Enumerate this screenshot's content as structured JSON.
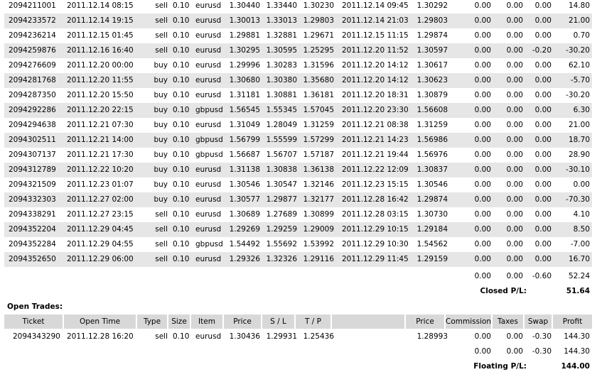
{
  "closed_trades": [
    {
      "ticket": "2094211001",
      "open_time": "2011.12.14 08:15",
      "type": "sell",
      "size": "0.10",
      "item": "eurusd",
      "price": "1.30440",
      "sl": "1.33440",
      "tp": "1.30230",
      "close_time": "2011.12.14 09:45",
      "close_price": "1.30292",
      "commission": "0.00",
      "taxes": "0.00",
      "swap": "0.00",
      "profit": "14.80"
    },
    {
      "ticket": "2094233572",
      "open_time": "2011.12.14 19:15",
      "type": "sell",
      "size": "0.10",
      "item": "eurusd",
      "price": "1.30013",
      "sl": "1.33013",
      "tp": "1.29803",
      "close_time": "2011.12.14 21:03",
      "close_price": "1.29803",
      "commission": "0.00",
      "taxes": "0.00",
      "swap": "0.00",
      "profit": "21.00"
    },
    {
      "ticket": "2094236214",
      "open_time": "2011.12.15 01:45",
      "type": "sell",
      "size": "0.10",
      "item": "eurusd",
      "price": "1.29881",
      "sl": "1.32881",
      "tp": "1.29671",
      "close_time": "2011.12.15 11:15",
      "close_price": "1.29874",
      "commission": "0.00",
      "taxes": "0.00",
      "swap": "0.00",
      "profit": "0.70"
    },
    {
      "ticket": "2094259876",
      "open_time": "2011.12.16 16:40",
      "type": "sell",
      "size": "0.10",
      "item": "eurusd",
      "price": "1.30295",
      "sl": "1.30595",
      "tp": "1.25295",
      "close_time": "2011.12.20 11:52",
      "close_price": "1.30597",
      "commission": "0.00",
      "taxes": "0.00",
      "swap": "-0.20",
      "profit": "-30.20"
    },
    {
      "ticket": "2094276609",
      "open_time": "2011.12.20 00:00",
      "type": "buy",
      "size": "0.10",
      "item": "eurusd",
      "price": "1.29996",
      "sl": "1.30283",
      "tp": "1.31596",
      "close_time": "2011.12.20 14:12",
      "close_price": "1.30617",
      "commission": "0.00",
      "taxes": "0.00",
      "swap": "0.00",
      "profit": "62.10"
    },
    {
      "ticket": "2094281768",
      "open_time": "2011.12.20 11:55",
      "type": "buy",
      "size": "0.10",
      "item": "eurusd",
      "price": "1.30680",
      "sl": "1.30380",
      "tp": "1.35680",
      "close_time": "2011.12.20 14:12",
      "close_price": "1.30623",
      "commission": "0.00",
      "taxes": "0.00",
      "swap": "0.00",
      "profit": "-5.70"
    },
    {
      "ticket": "2094287350",
      "open_time": "2011.12.20 15:50",
      "type": "buy",
      "size": "0.10",
      "item": "eurusd",
      "price": "1.31181",
      "sl": "1.30881",
      "tp": "1.36181",
      "close_time": "2011.12.20 18:31",
      "close_price": "1.30879",
      "commission": "0.00",
      "taxes": "0.00",
      "swap": "0.00",
      "profit": "-30.20"
    },
    {
      "ticket": "2094292286",
      "open_time": "2011.12.20 22:15",
      "type": "buy",
      "size": "0.10",
      "item": "gbpusd",
      "price": "1.56545",
      "sl": "1.55345",
      "tp": "1.57045",
      "close_time": "2011.12.20 23:30",
      "close_price": "1.56608",
      "commission": "0.00",
      "taxes": "0.00",
      "swap": "0.00",
      "profit": "6.30"
    },
    {
      "ticket": "2094294638",
      "open_time": "2011.12.21 07:30",
      "type": "buy",
      "size": "0.10",
      "item": "eurusd",
      "price": "1.31049",
      "sl": "1.28049",
      "tp": "1.31259",
      "close_time": "2011.12.21 08:38",
      "close_price": "1.31259",
      "commission": "0.00",
      "taxes": "0.00",
      "swap": "0.00",
      "profit": "21.00"
    },
    {
      "ticket": "2094302511",
      "open_time": "2011.12.21 14:00",
      "type": "buy",
      "size": "0.10",
      "item": "gbpusd",
      "price": "1.56799",
      "sl": "1.55599",
      "tp": "1.57299",
      "close_time": "2011.12.21 14:23",
      "close_price": "1.56986",
      "commission": "0.00",
      "taxes": "0.00",
      "swap": "0.00",
      "profit": "18.70"
    },
    {
      "ticket": "2094307137",
      "open_time": "2011.12.21 17:30",
      "type": "buy",
      "size": "0.10",
      "item": "gbpusd",
      "price": "1.56687",
      "sl": "1.56707",
      "tp": "1.57187",
      "close_time": "2011.12.21 19:44",
      "close_price": "1.56976",
      "commission": "0.00",
      "taxes": "0.00",
      "swap": "0.00",
      "profit": "28.90"
    },
    {
      "ticket": "2094312789",
      "open_time": "2011.12.22 10:20",
      "type": "buy",
      "size": "0.10",
      "item": "eurusd",
      "price": "1.31138",
      "sl": "1.30838",
      "tp": "1.36138",
      "close_time": "2011.12.22 12:09",
      "close_price": "1.30837",
      "commission": "0.00",
      "taxes": "0.00",
      "swap": "0.00",
      "profit": "-30.10"
    },
    {
      "ticket": "2094321509",
      "open_time": "2011.12.23 01:07",
      "type": "buy",
      "size": "0.10",
      "item": "eurusd",
      "price": "1.30546",
      "sl": "1.30547",
      "tp": "1.32146",
      "close_time": "2011.12.23 15:15",
      "close_price": "1.30546",
      "commission": "0.00",
      "taxes": "0.00",
      "swap": "0.00",
      "profit": "0.00"
    },
    {
      "ticket": "2094332303",
      "open_time": "2011.12.27 02:00",
      "type": "buy",
      "size": "0.10",
      "item": "eurusd",
      "price": "1.30577",
      "sl": "1.29877",
      "tp": "1.32177",
      "close_time": "2011.12.28 16:42",
      "close_price": "1.29874",
      "commission": "0.00",
      "taxes": "0.00",
      "swap": "0.00",
      "profit": "-70.30"
    },
    {
      "ticket": "2094338291",
      "open_time": "2011.12.27 23:15",
      "type": "sell",
      "size": "0.10",
      "item": "eurusd",
      "price": "1.30689",
      "sl": "1.27689",
      "tp": "1.30899",
      "close_time": "2011.12.28 03:15",
      "close_price": "1.30730",
      "commission": "0.00",
      "taxes": "0.00",
      "swap": "0.00",
      "profit": "4.10"
    },
    {
      "ticket": "2094352204",
      "open_time": "2011.12.29 04:45",
      "type": "sell",
      "size": "0.10",
      "item": "eurusd",
      "price": "1.29269",
      "sl": "1.29259",
      "tp": "1.29009",
      "close_time": "2011.12.29 10:15",
      "close_price": "1.29184",
      "commission": "0.00",
      "taxes": "0.00",
      "swap": "0.00",
      "profit": "8.50"
    },
    {
      "ticket": "2094352284",
      "open_time": "2011.12.29 04:55",
      "type": "sell",
      "size": "0.10",
      "item": "gbpusd",
      "price": "1.54492",
      "sl": "1.55692",
      "tp": "1.53992",
      "close_time": "2011.12.29 10:30",
      "close_price": "1.54562",
      "commission": "0.00",
      "taxes": "0.00",
      "swap": "0.00",
      "profit": "-7.00"
    },
    {
      "ticket": "2094352650",
      "open_time": "2011.12.29 06:00",
      "type": "sell",
      "size": "0.10",
      "item": "eurusd",
      "price": "1.29326",
      "sl": "1.32326",
      "tp": "1.29116",
      "close_time": "2011.12.29 11:45",
      "close_price": "1.29159",
      "commission": "0.00",
      "taxes": "0.00",
      "swap": "0.00",
      "profit": "16.70"
    }
  ],
  "closed_totals": {
    "commission": "0.00",
    "taxes": "0.00",
    "swap": "-0.60",
    "profit": "52.24"
  },
  "closed_pl": {
    "label": "Closed P/L:",
    "value": "51.64"
  },
  "open_section_title": "Open Trades:",
  "open_headers": {
    "ticket": "Ticket",
    "open_time": "Open Time",
    "type": "Type",
    "size": "Size",
    "item": "Item",
    "price": "Price",
    "sl": "S / L",
    "tp": "T / P",
    "blank": "",
    "cur_price": "Price",
    "commission": "Commission",
    "taxes": "Taxes",
    "swap": "Swap",
    "profit": "Profit"
  },
  "open_trades": [
    {
      "ticket": "2094343290",
      "open_time": "2011.12.28 16:20",
      "type": "sell",
      "size": "0.10",
      "item": "eurusd",
      "price": "1.30436",
      "sl": "1.29931",
      "tp": "1.25436",
      "cur_price": "1.28993",
      "commission": "0.00",
      "taxes": "0.00",
      "swap": "-0.30",
      "profit": "144.30"
    }
  ],
  "open_totals": {
    "commission": "0.00",
    "taxes": "0.00",
    "swap": "-0.30",
    "profit": "144.30"
  },
  "floating_pl": {
    "label": "Floating P/L:",
    "value": "144.00"
  }
}
